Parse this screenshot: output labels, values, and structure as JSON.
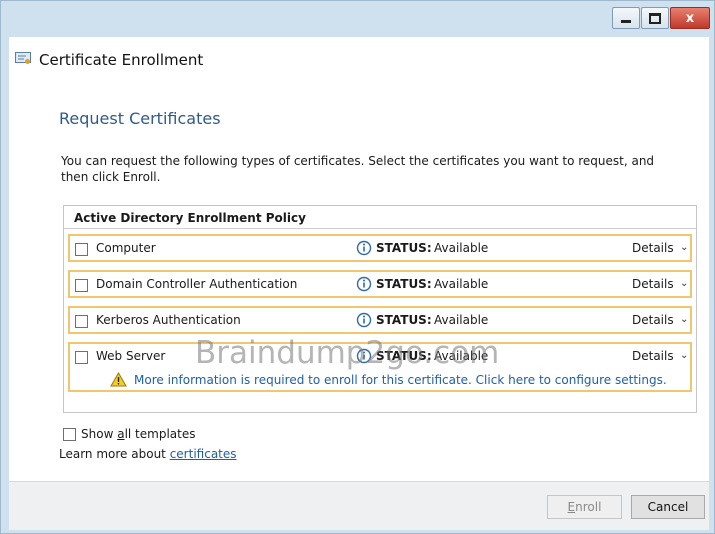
{
  "window": {
    "title": "Certificate Enrollment",
    "close_glyph": "x"
  },
  "page": {
    "heading": "Request Certificates",
    "description": "You can request the following types of certificates. Select the certificates you want to request, and then click Enroll."
  },
  "policy": {
    "title": "Active Directory Enrollment Policy",
    "status_key": "STATUS:",
    "details_label": "Details",
    "items": [
      {
        "label": "Computer",
        "status": "Available"
      },
      {
        "label": "Domain Controller Authentication",
        "status": "Available"
      },
      {
        "label": "Kerberos Authentication",
        "status": "Available"
      },
      {
        "label": "Web Server",
        "status": "Available",
        "warning": "More information is required to enroll for this certificate. Click here to configure settings."
      }
    ]
  },
  "options": {
    "show_all_prefix": "Show ",
    "show_all_accel": "a",
    "show_all_suffix": "ll templates",
    "learn_more_text": "Learn more about ",
    "learn_more_link": "certificates"
  },
  "buttons": {
    "enroll_accel": "E",
    "enroll_rest": "nroll",
    "cancel": "Cancel"
  },
  "watermark": "Braindump2go.com",
  "icons": {
    "app": "certificate-icon",
    "status": "info-icon",
    "warning": "warning-icon",
    "chevron": "chevron-down-icon"
  },
  "colors": {
    "highlight_border": "#f0c66e",
    "link": "#1f5fa8",
    "heading": "#2f5a8a",
    "close_button": "#c0392b"
  }
}
